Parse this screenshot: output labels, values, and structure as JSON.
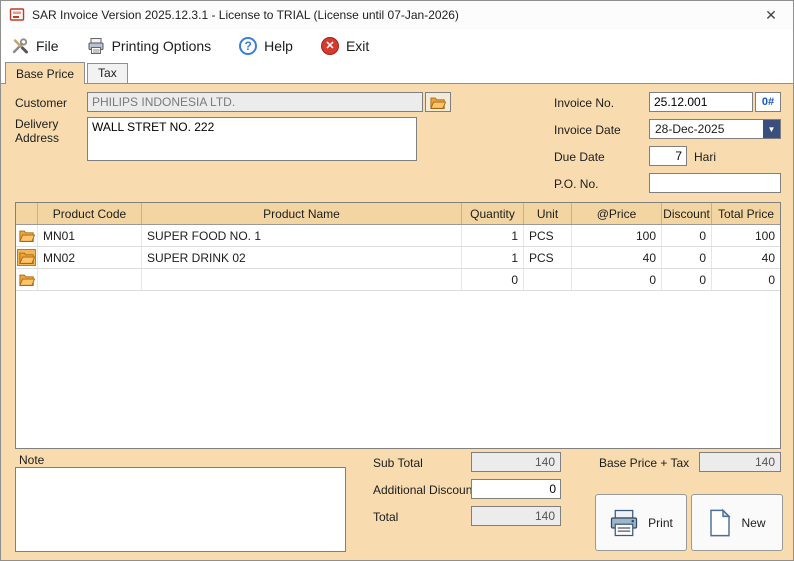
{
  "window": {
    "title": "SAR Invoice Version 2025.12.3.1 - License to TRIAL (License until 07-Jan-2026)"
  },
  "icons": {
    "close": "✕",
    "help": "?",
    "exit": "✕",
    "combo_arrow": "▼"
  },
  "menu": {
    "file": "File",
    "printing_options": "Printing Options",
    "help": "Help",
    "exit": "Exit"
  },
  "tabs": {
    "base_price": "Base Price",
    "tax": "Tax"
  },
  "form": {
    "customer_label": "Customer",
    "customer_value": "PHILIPS INDONESIA LTD.",
    "delivery_label": "Delivery Address",
    "delivery_value": "WALL STRET NO. 222",
    "invoice_no_label": "Invoice No.",
    "invoice_no_value": "25.12.001",
    "invoice_no_button": "0#",
    "invoice_date_label": "Invoice Date",
    "invoice_date_value": "28-Dec-2025",
    "due_date_label": "Due Date",
    "due_date_value": "7",
    "due_date_unit": "Hari",
    "po_label": "P.O. No.",
    "po_value": ""
  },
  "table": {
    "headers": [
      "Product Code",
      "Product Name",
      "Quantity",
      "Unit",
      "@Price",
      "Discount",
      "Total Price"
    ],
    "rows": [
      {
        "code": "MN01",
        "name": "SUPER FOOD NO. 1",
        "qty": "1",
        "unit": "PCS",
        "price": "100",
        "discount": "0",
        "total": "100"
      },
      {
        "code": "MN02",
        "name": "SUPER DRINK 02",
        "qty": "1",
        "unit": "PCS",
        "price": "40",
        "discount": "0",
        "total": "40"
      },
      {
        "code": "",
        "name": "",
        "qty": "0",
        "unit": "",
        "price": "0",
        "discount": "0",
        "total": "0"
      }
    ]
  },
  "footer": {
    "note_label": "Note",
    "note_value": "",
    "sub_total_label": "Sub Total",
    "sub_total_value": "140",
    "additional_discount_label": "Additional Discount",
    "additional_discount_value": "0",
    "total_label": "Total",
    "total_value": "140",
    "base_price_tax_label": "Base Price + Tax",
    "base_price_tax_value": "140",
    "print_label": "Print",
    "new_label": "New"
  }
}
